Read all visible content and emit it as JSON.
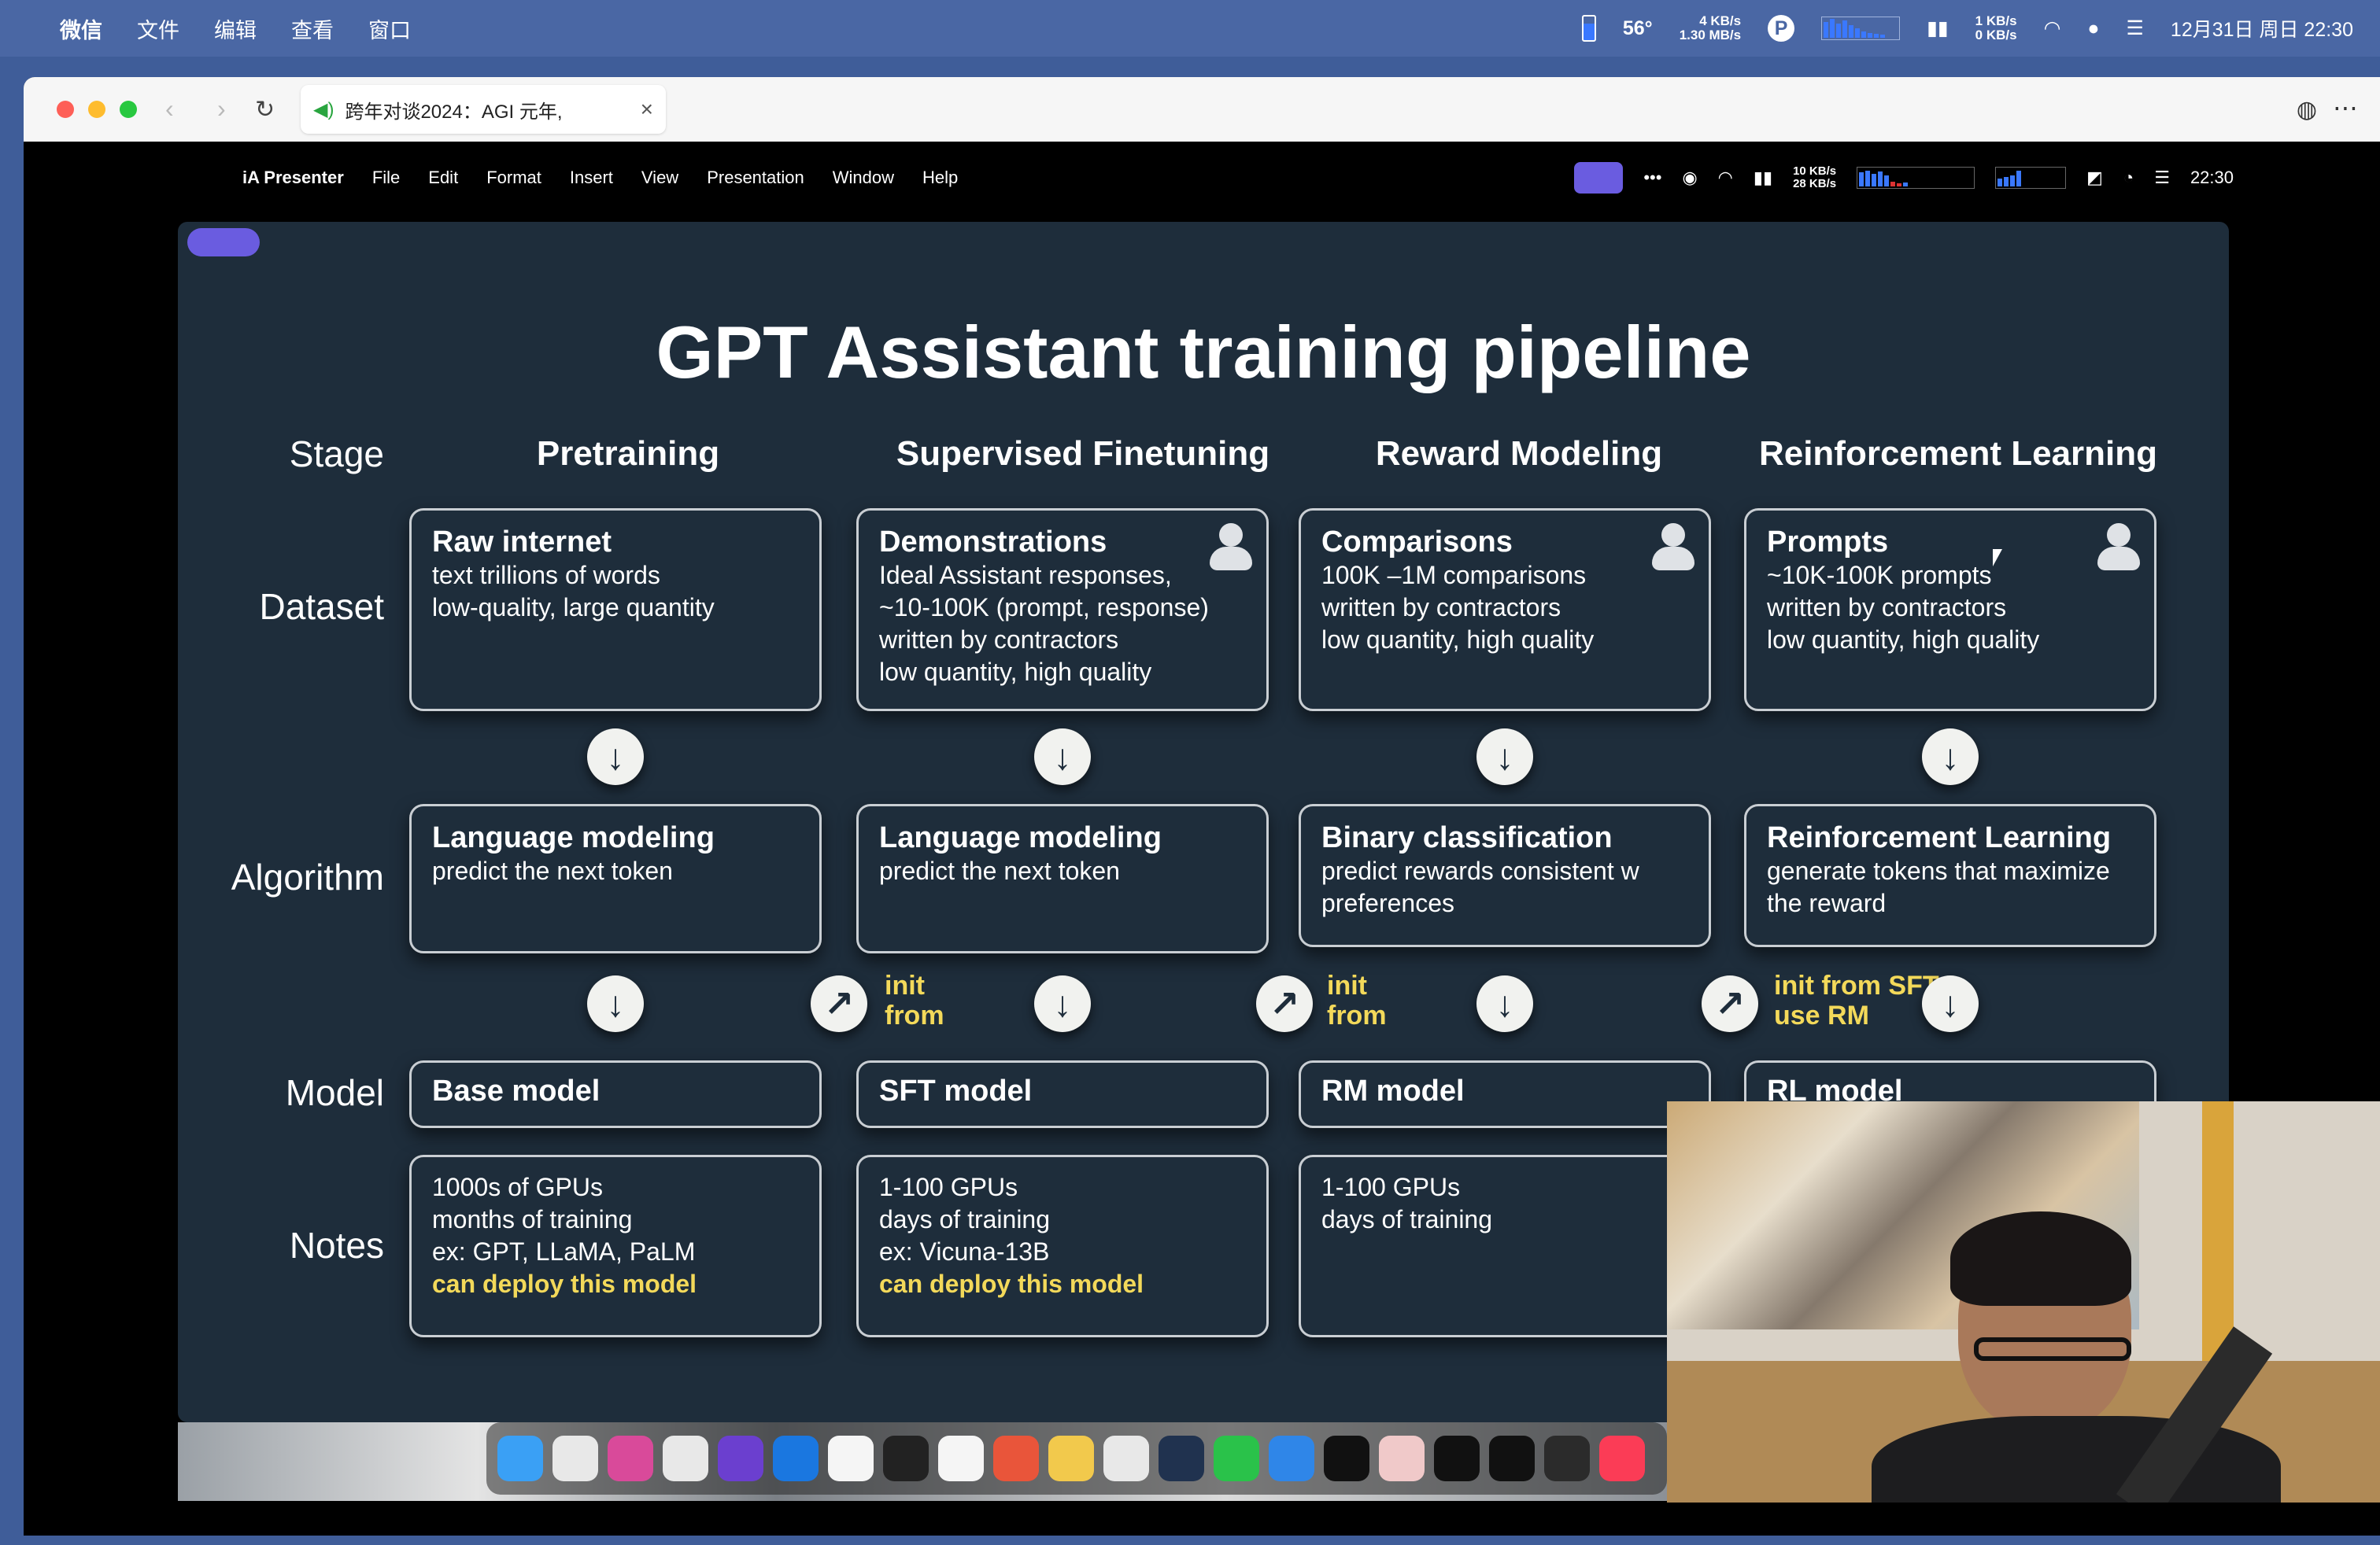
{
  "outer_menubar": {
    "items": [
      "微信",
      "文件",
      "编辑",
      "查看",
      "窗口"
    ],
    "temp": "56°",
    "net_up": "4 KB/s",
    "net_down": "1.30 MB/s",
    "net2_up": "1 KB/s",
    "net2_down": "0 KB/s",
    "clock": "12月31日 周日 22:30"
  },
  "browser": {
    "tab_title": "跨年对谈2024：AGI 元年,"
  },
  "inner_menubar": {
    "app": "iA Presenter",
    "items": [
      "File",
      "Edit",
      "Format",
      "Insert",
      "View",
      "Presentation",
      "Window",
      "Help"
    ],
    "net_up": "10 KB/s",
    "net_down": "28 KB/s",
    "clock": "22:30"
  },
  "slide": {
    "title": "GPT Assistant training pipeline",
    "row_labels": {
      "stage": "Stage",
      "dataset": "Dataset",
      "algorithm": "Algorithm",
      "model": "Model",
      "notes": "Notes"
    },
    "columns": [
      {
        "stage": "Pretraining",
        "dataset_title": "Raw internet",
        "dataset_lines": [
          "text trillions of words",
          "low-quality, large quantity"
        ],
        "algorithm_title": "Language modeling",
        "algorithm_lines": [
          "predict the next token"
        ],
        "model": "Base model",
        "notes_lines": [
          "1000s of GPUs",
          "months of training",
          "ex: GPT, LLaMA, PaLM"
        ],
        "notes_highlight": "can deploy this model"
      },
      {
        "stage": "Supervised Finetuning",
        "dataset_title": "Demonstrations",
        "dataset_lines": [
          "Ideal Assistant responses,",
          "~10-100K (prompt, response)",
          "written by contractors",
          "low quantity, high quality"
        ],
        "algorithm_title": "Language modeling",
        "algorithm_lines": [
          "predict the next token"
        ],
        "init_label": [
          "init",
          "from"
        ],
        "model": "SFT model",
        "notes_lines": [
          "1-100 GPUs",
          "days of training",
          "ex: Vicuna-13B"
        ],
        "notes_highlight": "can deploy this model"
      },
      {
        "stage": "Reward Modeling",
        "dataset_title": "Comparisons",
        "dataset_lines": [
          "100K –1M comparisons",
          "written by contractors",
          "low quantity, high quality"
        ],
        "algorithm_title": "Binary classification",
        "algorithm_lines": [
          "predict rewards consistent w",
          "preferences"
        ],
        "init_label": [
          "init",
          "from"
        ],
        "model": "RM model",
        "notes_lines": [
          "1-100 GPUs",
          "days of training"
        ]
      },
      {
        "stage": "Reinforcement Learning",
        "dataset_title": "Prompts",
        "dataset_lines": [
          "~10K-100K prompts",
          "written by contractors",
          "low quantity, high quality"
        ],
        "algorithm_title": "Reinforcement Learning",
        "algorithm_lines": [
          "generate tokens that maximize",
          "the reward"
        ],
        "init_label": [
          "init from SFT",
          "use RM"
        ],
        "model": "RL model"
      }
    ]
  },
  "dock": {
    "apps": [
      "finder-icon",
      "launchpad-icon",
      "pixelmator-icon",
      "chrome-icon",
      "obsidian-icon",
      "trello-icon",
      "notion-icon",
      "figma-icon",
      "tasks-icon",
      "swift-icon",
      "notes-icon",
      "paw-icon",
      "r-icon",
      "wechat-icon",
      "browser-icon",
      "chatgpt-icon",
      "brain-icon",
      "openai-icon",
      "pycharm-icon",
      "obs-icon",
      "music-icon"
    ]
  },
  "colors": {
    "slide_bg": "#1e2d3b",
    "highlight": "#f3d95a",
    "accent": "#6a5ce0"
  }
}
